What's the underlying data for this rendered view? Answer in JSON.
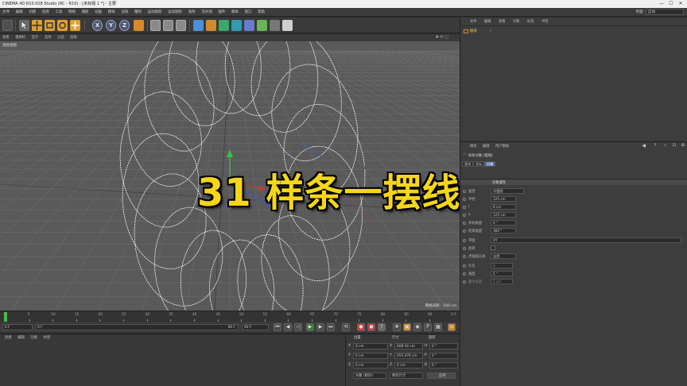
{
  "app": {
    "title": "CINEMA 4D R10.028 Studio (RC - R10) - [未标题 1 *] - 主要",
    "window_buttons": {
      "minimize": "—",
      "maximize": "☐",
      "close": "✕"
    },
    "layout_label": "界面:",
    "layout_value": "启动"
  },
  "menu": [
    "文件",
    "编辑",
    "创建",
    "选择",
    "工具",
    "网格",
    "捕捉",
    "动画",
    "模拟",
    "渲染",
    "雕刻",
    "运动跟踪",
    "运动图形",
    "角色",
    "流水线",
    "插件",
    "脚本",
    "窗口",
    "帮助"
  ],
  "toolbar": {
    "axes": [
      "X",
      "Y",
      "Z"
    ]
  },
  "viewport_menu": [
    "查看",
    "摄像机",
    "显示",
    "选项",
    "过滤",
    "面板"
  ],
  "viewport": {
    "label": "透视视图",
    "grid_spacing": "网格间距 : 100 cm"
  },
  "overlay_title": "31 样条一摆线",
  "timeline": {
    "ticks": [
      "0",
      "5",
      "10",
      "15",
      "20",
      "25",
      "30",
      "35",
      "40",
      "45",
      "50",
      "55",
      "60",
      "65",
      "70",
      "75",
      "80",
      "85",
      "90"
    ],
    "current_frame_unit": "0 F"
  },
  "transport": {
    "start_frame": "0 F",
    "current_frame": "0 F",
    "end_frame": "90 F",
    "max_frame": "90 F"
  },
  "materials_menu": [
    "创建",
    "编辑",
    "功能",
    "纹理"
  ],
  "coordinates": {
    "headers": [
      "位置",
      "尺寸",
      "旋转"
    ],
    "rows": [
      {
        "axis": "X",
        "pos": "0 cm",
        "size_axis": "X",
        "size": "608.54 cm",
        "rot_axis": "H",
        "rot": "0 °"
      },
      {
        "axis": "Y",
        "pos": "0 cm",
        "size_axis": "Y",
        "size": "655.476 cm",
        "rot_axis": "P",
        "rot": "0 °"
      },
      {
        "axis": "Z",
        "pos": "0 cm",
        "size_axis": "Z",
        "size": "0 cm",
        "rot_axis": "B",
        "rot": "0 °"
      }
    ],
    "mode_object": "对象 (相对)",
    "mode_size": "绝对尺寸",
    "apply_button": "应用"
  },
  "object_manager": {
    "tabs": [
      "文件",
      "编辑",
      "查看",
      "对象",
      "标签",
      "书签"
    ],
    "object_name": "摆线"
  },
  "attribute_manager": {
    "tabs": [
      "模式",
      "编辑",
      "用户数据"
    ],
    "object_title": "样条对象 [摆线]",
    "subtabs": [
      "基本",
      "坐标",
      "对象"
    ],
    "section_object": "对象属性",
    "fields": [
      {
        "label": "类型",
        "value": "内摆线"
      },
      {
        "label": "半径",
        "value": "125 cm"
      },
      {
        "label": "r",
        "value": "8 cm"
      },
      {
        "label": "a",
        "value": "125 cm"
      },
      {
        "label": "开始角度",
        "value": "0 °"
      },
      {
        "label": "结束角度",
        "value": "360 °"
      }
    ],
    "plane_label": "平面",
    "plane_value": "XY",
    "reverse_label": "反转",
    "section_interp": "点插值方式",
    "interp_value": "自然",
    "interp_fields": [
      {
        "label": "数量",
        "value": "8"
      },
      {
        "label": "角度",
        "value": "5 °"
      },
      {
        "label": "最大长度",
        "value": "5 cm"
      }
    ]
  }
}
